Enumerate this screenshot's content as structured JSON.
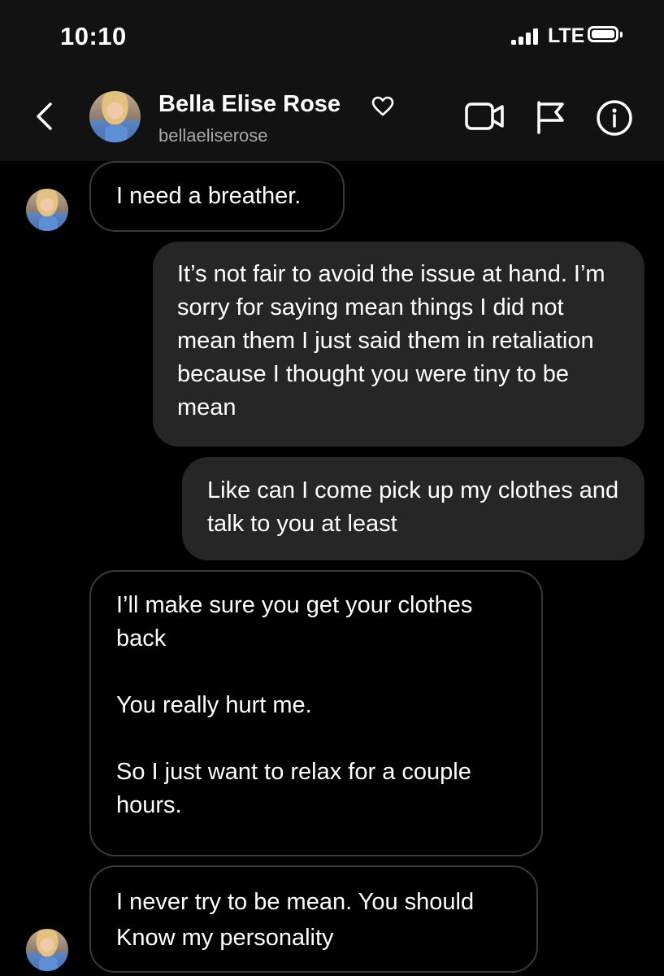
{
  "status_bar": {
    "time": "10:10",
    "network": "LTE",
    "battery_level": 1.0
  },
  "header": {
    "contact_name": "Bella Elise Rose",
    "username": "bellaeliserose",
    "icons": [
      "back-chevron-icon",
      "heart-icon",
      "video-call-icon",
      "flag-icon",
      "info-icon"
    ]
  },
  "messages": [
    {
      "from": "them",
      "paragraphs": [
        "I need a breather."
      ]
    },
    {
      "from": "me",
      "paragraphs": [
        "It’s not fair to avoid the issue at hand. I’m sorry for saying mean things I did not mean them I just said them in retaliation because I thought you were tiny to be mean"
      ]
    },
    {
      "from": "me",
      "paragraphs": [
        "Like can I come pick up my clothes and talk to you at least"
      ]
    },
    {
      "from": "them",
      "paragraphs": [
        "I’ll make sure you get your clothes back",
        "You really hurt me.",
        "So I just want to relax for a couple hours."
      ]
    },
    {
      "from": "them",
      "paragraphs": [
        "I never try to be mean. You should Know my personality"
      ]
    }
  ],
  "colors": {
    "background": "#000000",
    "header": "#121212",
    "outgoing_bubble": "#262626",
    "incoming_border": "#3a3a3a",
    "secondary_text": "#a8a8a8"
  }
}
